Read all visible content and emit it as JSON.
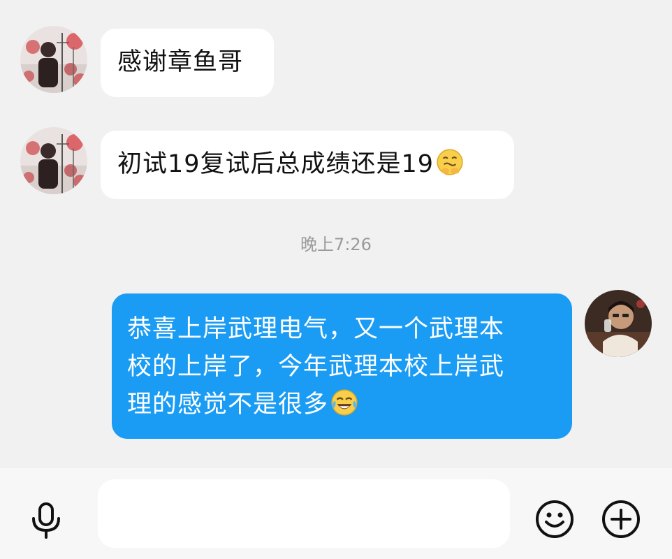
{
  "messages": [
    {
      "sender": "contact",
      "text": "感谢章鱼哥",
      "emoji": ""
    },
    {
      "sender": "contact",
      "text": "初试19复试后总成绩还是19",
      "emoji": "grimacing-face-emoji"
    },
    {
      "sender": "self",
      "lines": [
        "恭喜上岸武理电气，又一个武理本",
        "校的上岸了，今年武理本校上岸武",
        "理的感觉不是很多"
      ],
      "emoji": "tears-of-joy-emoji"
    }
  ],
  "timestamp": "晚上7:26",
  "input_bar": {
    "placeholder": "",
    "value": "",
    "left_icon": "microphone-icon",
    "right_icons": [
      "smiley-icon",
      "plus-circle-icon"
    ]
  },
  "colors": {
    "background": "#f1f1f1",
    "incoming_bubble": "#ffffff",
    "outgoing_bubble": "#1a9cf5",
    "timestamp_text": "#9a9a9a"
  }
}
